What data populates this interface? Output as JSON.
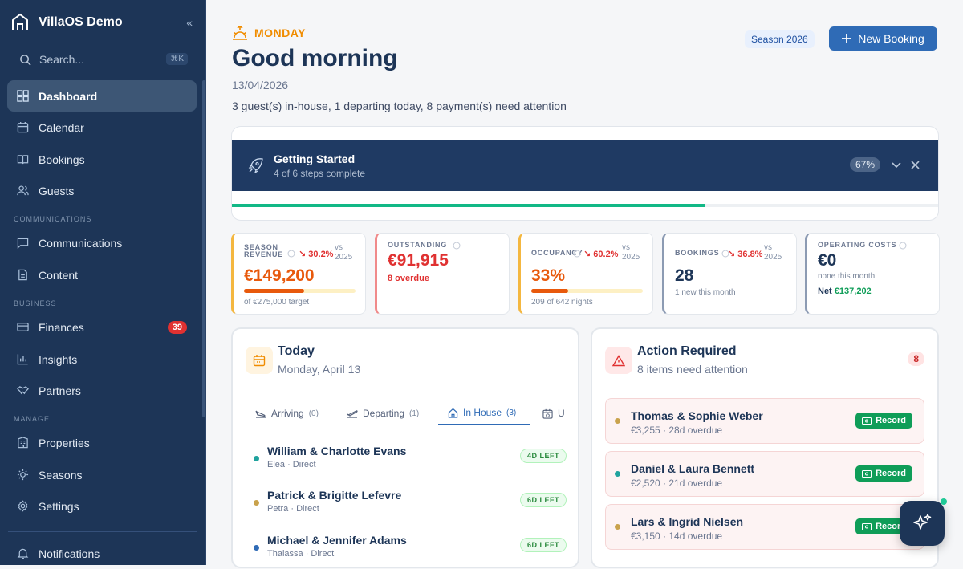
{
  "app": {
    "title": "VillaOS Demo"
  },
  "sidebar": {
    "search_placeholder": "Search...",
    "search_shortcut": "⌘K",
    "items": [
      {
        "label": "Dashboard",
        "icon": "grid-icon",
        "active": true
      },
      {
        "label": "Calendar",
        "icon": "calendar-icon"
      },
      {
        "label": "Bookings",
        "icon": "book-icon"
      },
      {
        "label": "Guests",
        "icon": "users-icon"
      },
      {
        "label": "Communications",
        "icon": "message-icon"
      },
      {
        "label": "Content",
        "icon": "file-icon"
      },
      {
        "label": "Finances",
        "icon": "card-icon",
        "badge": "39"
      },
      {
        "label": "Insights",
        "icon": "bar-chart-icon"
      },
      {
        "label": "Partners",
        "icon": "handshake-icon"
      },
      {
        "label": "Properties",
        "icon": "building-icon"
      },
      {
        "label": "Seasons",
        "icon": "sun-icon"
      },
      {
        "label": "Settings",
        "icon": "gear-icon"
      },
      {
        "label": "Notifications",
        "icon": "bell-icon"
      }
    ],
    "sections": {
      "communications": "COMMUNICATIONS",
      "business": "BUSINESS",
      "manage": "MANAGE"
    }
  },
  "header": {
    "day": "MONDAY",
    "greeting": "Good morning",
    "date": "13/04/2026",
    "summary": "3 guest(s) in-house, 1 departing today, 8 payment(s) need attention",
    "season": "Season 2026",
    "new_booking": "New Booking"
  },
  "getting_started": {
    "title": "Getting Started",
    "subtitle": "4 of 6 steps complete",
    "percent_label": "67%",
    "progress": 0.67
  },
  "kpis": [
    {
      "label": "SEASON REVENUE",
      "delta": "↘ 30.2%",
      "vs": "vs 2025",
      "value": "€149,200",
      "note": "of €275,000 target",
      "progress": 0.54,
      "color": "#e8590c"
    },
    {
      "label": "OUTSTANDING",
      "value": "€91,915",
      "note": "8 overdue",
      "color": "#e03131"
    },
    {
      "label": "OCCUPANCY",
      "delta": "↘ 60.2%",
      "vs": "vs 2025",
      "value": "33%",
      "note": "209 of 642 nights",
      "progress": 0.33,
      "color": "#e8590c"
    },
    {
      "label": "BOOKINGS",
      "delta": "↘ 36.8%",
      "vs": "vs 2025",
      "value": "28",
      "note": "1 new this month",
      "color": "#1d3557"
    },
    {
      "label": "OPERATING COSTS",
      "value": "€0",
      "note": "none this month",
      "net_label": "Net",
      "net_value": "€137,202",
      "color": "#1d3557"
    }
  ],
  "today": {
    "title": "Today",
    "subtitle": "Monday, April 13",
    "tabs": [
      {
        "label": "Arriving",
        "count": "(0)"
      },
      {
        "label": "Departing",
        "count": "(1)"
      },
      {
        "label": "In House",
        "count": "(3)",
        "active": true
      },
      {
        "label": "U",
        "count": ""
      }
    ],
    "guests": [
      {
        "name": "William & Charlotte Evans",
        "meta": "Elea · Direct",
        "pill": "4D LEFT",
        "dot": "#20a39e"
      },
      {
        "name": "Patrick & Brigitte Lefevre",
        "meta": "Petra · Direct",
        "pill": "6D LEFT",
        "dot": "#c9a24c"
      },
      {
        "name": "Michael & Jennifer Adams",
        "meta": "Thalassa · Direct",
        "pill": "6D LEFT",
        "dot": "#2f6bb6"
      }
    ]
  },
  "actions": {
    "title": "Action Required",
    "subtitle": "8 items need attention",
    "count": "8",
    "items": [
      {
        "name": "Thomas & Sophie Weber",
        "meta": "€3,255 · 28d overdue",
        "button": "Record",
        "dot": "#c9a24c"
      },
      {
        "name": "Daniel & Laura Bennett",
        "meta": "€2,520 · 21d overdue",
        "button": "Record",
        "dot": "#20a39e"
      },
      {
        "name": "Lars & Ingrid Nielsen",
        "meta": "€3,150 · 14d overdue",
        "button": "Record",
        "dot": "#c9a24c"
      }
    ]
  }
}
